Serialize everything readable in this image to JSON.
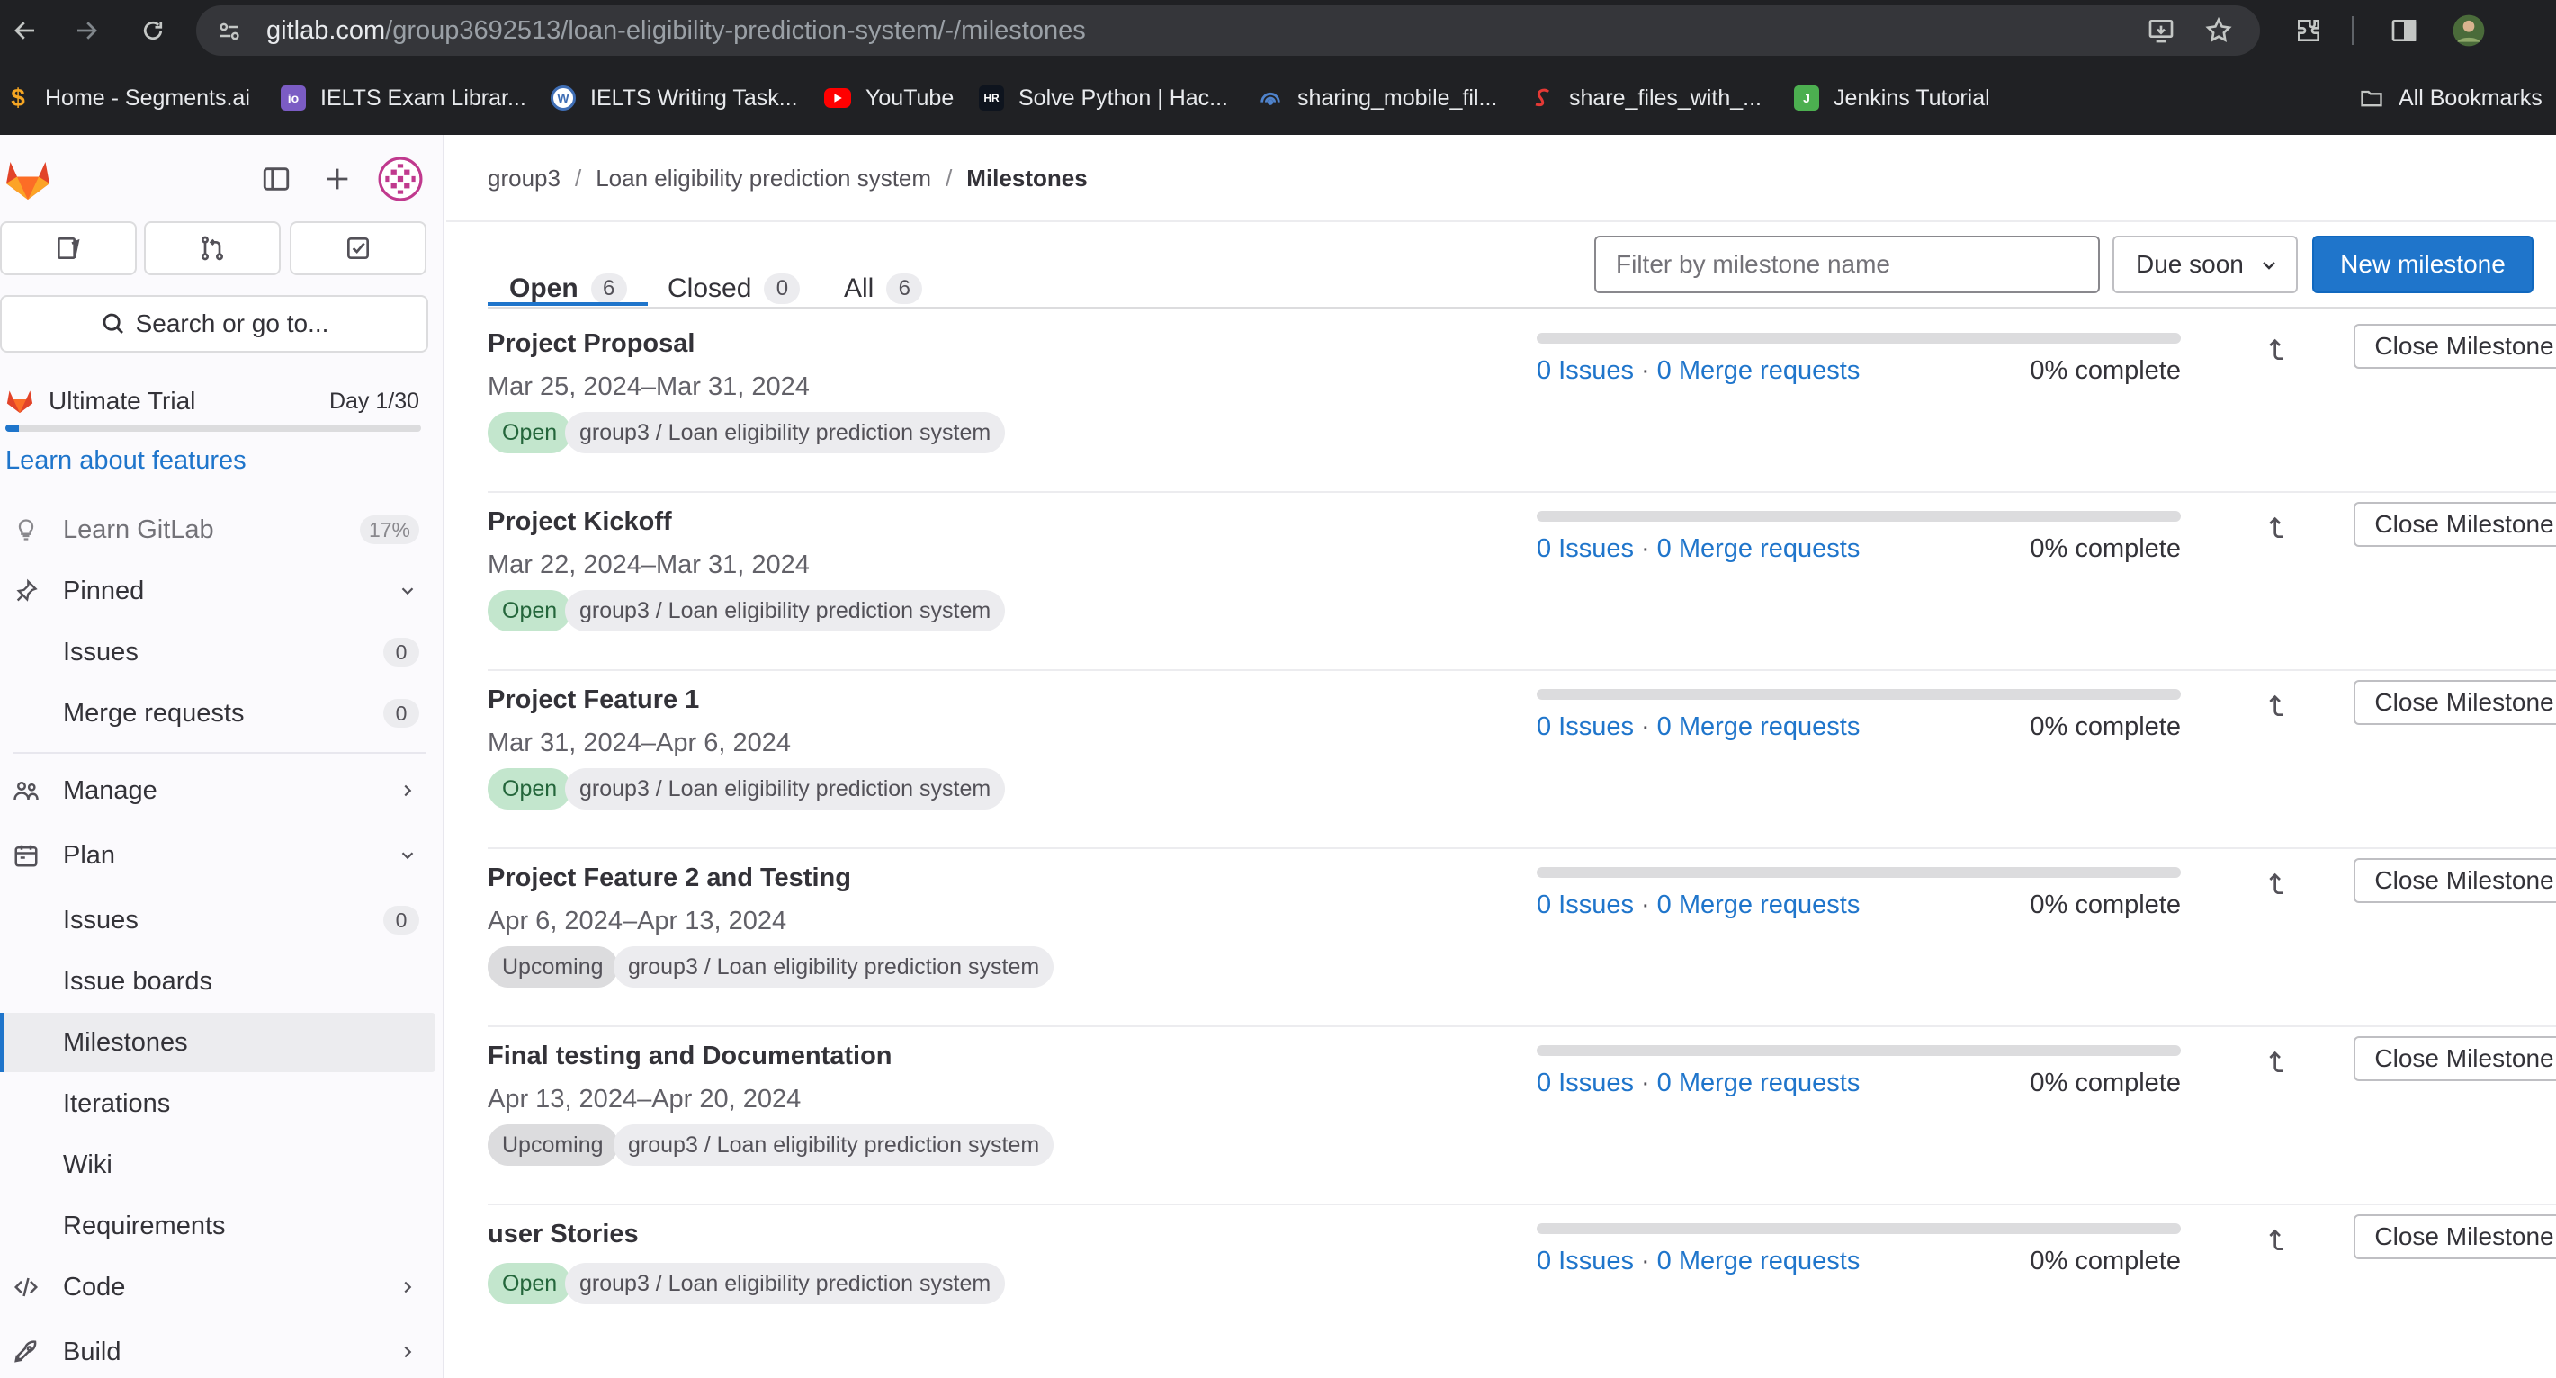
{
  "browser": {
    "url_domain": "gitlab.com",
    "url_path": "/group3692513/loan-eligibility-prediction-system/-/milestones",
    "bookmarks": [
      {
        "label": "Home - Segments.ai",
        "icon": "segments-favicon",
        "color": "#f5a623"
      },
      {
        "label": "IELTS Exam Librar...",
        "icon": "ielts-favicon",
        "color": "#7b5cc4"
      },
      {
        "label": "IELTS Writing Task...",
        "icon": "wordpress-favicon",
        "color": "#3f6eb5"
      },
      {
        "label": "YouTube",
        "icon": "youtube-favicon",
        "color": "#ff0000"
      },
      {
        "label": "Solve Python | Hac...",
        "icon": "hackerrank-favicon",
        "color": "#0e141e"
      },
      {
        "label": "sharing_mobile_fil...",
        "icon": "share-favicon",
        "color": "#4f83cc"
      },
      {
        "label": "share_files_with_...",
        "icon": "share-red-favicon",
        "color": "#e53935"
      },
      {
        "label": "Jenkins Tutorial",
        "icon": "jenkins-favicon",
        "color": "#4caf50"
      }
    ],
    "all_bookmarks": "All Bookmarks"
  },
  "sidebar": {
    "search": "Search or go to...",
    "trial_title": "Ultimate Trial",
    "trial_day": "Day 1/30",
    "trial_progress": 0.033,
    "learn_features": "Learn about features",
    "learn_gitlab": "Learn GitLab",
    "learn_gitlab_pct": "17%",
    "pinned": "Pinned",
    "pinned_issues": "Issues",
    "pinned_issues_count": "0",
    "pinned_mr": "Merge requests",
    "pinned_mr_count": "0",
    "manage": "Manage",
    "plan": "Plan",
    "plan_issues": "Issues",
    "plan_issues_count": "0",
    "issue_boards": "Issue boards",
    "milestones": "Milestones",
    "iterations": "Iterations",
    "wiki": "Wiki",
    "requirements": "Requirements",
    "code": "Code",
    "build": "Build"
  },
  "breadcrumb": {
    "group": "group3",
    "project": "Loan eligibility prediction system",
    "current": "Milestones"
  },
  "tabs": {
    "open": "Open",
    "open_count": "6",
    "closed": "Closed",
    "closed_count": "0",
    "all": "All",
    "all_count": "6"
  },
  "filter": {
    "placeholder": "Filter by milestone name"
  },
  "sort": {
    "label": "Due soon"
  },
  "new_milestone": "New milestone",
  "milestones": [
    {
      "title": "Project Proposal",
      "dates": "Mar 25, 2024–Mar 31, 2024",
      "state": "Open",
      "project": "group3 / Loan eligibility prediction system",
      "issues": "0 Issues",
      "mrs": "0 Merge requests",
      "pct": "0% complete",
      "progress": 0,
      "close": "Close Milestone"
    },
    {
      "title": "Project Kickoff",
      "dates": "Mar 22, 2024–Mar 31, 2024",
      "state": "Open",
      "project": "group3 / Loan eligibility prediction system",
      "issues": "0 Issues",
      "mrs": "0 Merge requests",
      "pct": "0% complete",
      "progress": 0,
      "close": "Close Milestone"
    },
    {
      "title": "Project Feature 1",
      "dates": "Mar 31, 2024–Apr 6, 2024",
      "state": "Open",
      "project": "group3 / Loan eligibility prediction system",
      "issues": "0 Issues",
      "mrs": "0 Merge requests",
      "pct": "0% complete",
      "progress": 0,
      "close": "Close Milestone"
    },
    {
      "title": "Project Feature 2 and Testing",
      "dates": "Apr 6, 2024–Apr 13, 2024",
      "state": "Upcoming",
      "project": "group3 / Loan eligibility prediction system",
      "issues": "0 Issues",
      "mrs": "0 Merge requests",
      "pct": "0% complete",
      "progress": 0,
      "close": "Close Milestone"
    },
    {
      "title": "Final testing and Documentation",
      "dates": "Apr 13, 2024–Apr 20, 2024",
      "state": "Upcoming",
      "project": "group3 / Loan eligibility prediction system",
      "issues": "0 Issues",
      "mrs": "0 Merge requests",
      "pct": "0% complete",
      "progress": 0,
      "close": "Close Milestone"
    },
    {
      "title": "user Stories",
      "dates": "",
      "state": "Open",
      "project": "group3 / Loan eligibility prediction system",
      "issues": "0 Issues",
      "mrs": "0 Merge requests",
      "pct": "0% complete",
      "progress": 0,
      "close": "Close Milestone"
    }
  ],
  "colors": {
    "accent": "#1f75cb",
    "open_badge": "#c3e6cd",
    "upcoming_badge": "#dcdcde"
  }
}
